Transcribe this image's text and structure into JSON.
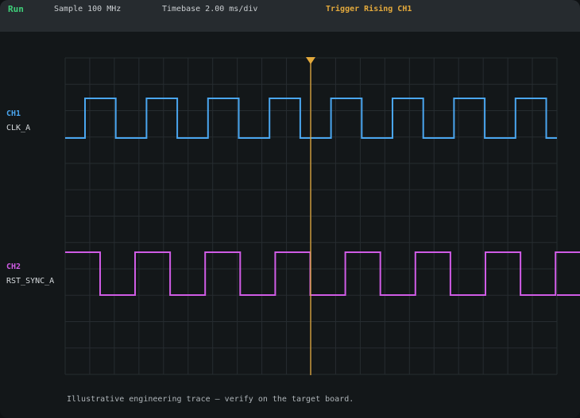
{
  "toolbar": {
    "run_status": "Run",
    "sample_rate": "Sample 100 MHz",
    "timebase": "Timebase 2.00 ms/div",
    "trigger": "Trigger Rising CH1"
  },
  "channels": [
    {
      "name": "CH1",
      "signal": "CLK_A",
      "color": "#4aa6f0",
      "rising_edges": 8,
      "start_level": "low"
    },
    {
      "name": "CH2",
      "signal": "RST_SYNC_A",
      "color": "#d05ce6",
      "rising_edges": 7,
      "start_level": "high"
    }
  ],
  "trigger_color": "#e3a93c",
  "footer_note": "Illustrative engineering trace — verify on the target board."
}
